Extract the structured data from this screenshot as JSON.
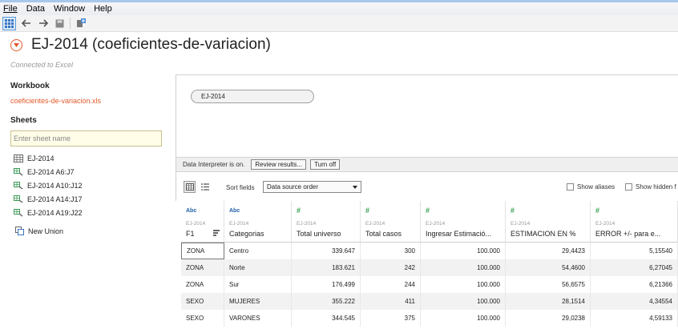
{
  "menu": [
    "File",
    "Data",
    "Window",
    "Help"
  ],
  "title": "EJ-2014 (coeficientes-de-variacion)",
  "connected": "Connected to Excel",
  "workbook": {
    "heading": "Workbook",
    "file": "coeficientes-de-variacion.xls"
  },
  "sheets": {
    "heading": "Sheets",
    "placeholder": "Enter sheet name",
    "items": [
      "EJ-2014",
      "EJ-2014 A6:J7",
      "EJ-2014 A10:J12",
      "EJ-2014 A14:J17",
      "EJ-2014 A19:J22"
    ],
    "new_union": "New Union"
  },
  "canvas": {
    "table": "EJ-2014"
  },
  "interpreter": {
    "text": "Data Interpreter is on.",
    "review": "Review results...",
    "turn_off": "Turn off"
  },
  "grid_toolbar": {
    "sort_label": "Sort fields",
    "sort_value": "Data source order",
    "show_aliases": "Show aliases",
    "show_hidden": "Show hidden f"
  },
  "columns": [
    {
      "type": "Abc",
      "source": "EJ-2014",
      "name": "F1"
    },
    {
      "type": "Abc",
      "source": "EJ-2014",
      "name": "Categorias"
    },
    {
      "type": "#",
      "source": "EJ-2014",
      "name": "Total universo"
    },
    {
      "type": "#",
      "source": "EJ-2014",
      "name": "Total casos"
    },
    {
      "type": "#",
      "source": "EJ-2014",
      "name": "Ingresar Estimació..."
    },
    {
      "type": "#",
      "source": "EJ-2014",
      "name": "ESTIMACION EN %"
    },
    {
      "type": "#",
      "source": "EJ-2014",
      "name": "ERROR +/- para e..."
    }
  ],
  "rows": [
    [
      "ZONA",
      "Centro",
      "339.647",
      "300",
      "100.000",
      "29,4423",
      "5,15540"
    ],
    [
      "ZONA",
      "Norte",
      "183.621",
      "242",
      "100.000",
      "54,4600",
      "6,27045"
    ],
    [
      "ZONA",
      "Sur",
      "176.499",
      "244",
      "100.000",
      "56,6575",
      "6,21366"
    ],
    [
      "SEXO",
      "MUJERES",
      "355.222",
      "411",
      "100.000",
      "28,1514",
      "4,34554"
    ],
    [
      "SEXO",
      "VARONES",
      "344.545",
      "375",
      "100.000",
      "29,0238",
      "4,59133"
    ]
  ]
}
